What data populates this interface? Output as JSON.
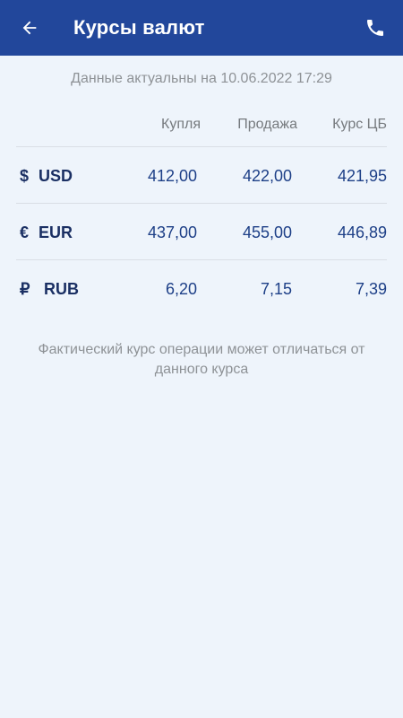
{
  "app_bar": {
    "title": "Курсы валют",
    "back_icon": "arrow-left-icon",
    "phone_icon": "phone-icon",
    "background_color": "#22479b"
  },
  "updated_text": "Данные актуальны на 10.06.2022 17:29",
  "table": {
    "headers": {
      "buy": "Купля",
      "sell": "Продажа",
      "cb": "Курс ЦБ"
    },
    "rows": [
      {
        "currency": "USD",
        "symbol": "$",
        "buy": "412,00",
        "sell": "422,00",
        "cb": "421,95"
      },
      {
        "currency": "EUR",
        "symbol": "€",
        "buy": "437,00",
        "sell": "455,00",
        "cb": "446,89"
      },
      {
        "currency": "RUB",
        "symbol": "₽",
        "buy": "6,20",
        "sell": "7,15",
        "cb": "7,39"
      }
    ]
  },
  "footer_note": "Фактический курс операции может отличаться от данного курса"
}
